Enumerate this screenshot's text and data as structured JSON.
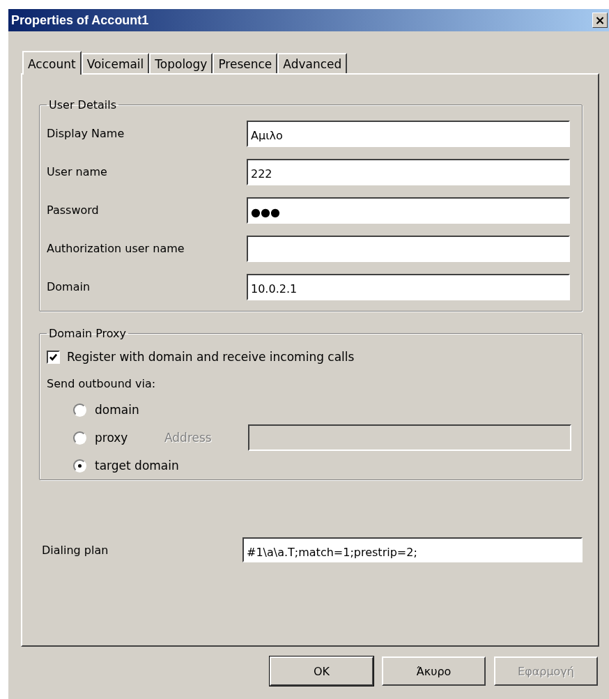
{
  "window": {
    "title": "Properties of Account1",
    "close": "×"
  },
  "tabs": [
    {
      "label": "Account",
      "selected": true
    },
    {
      "label": "Voicemail",
      "selected": false
    },
    {
      "label": "Topology",
      "selected": false
    },
    {
      "label": "Presence",
      "selected": false
    },
    {
      "label": "Advanced",
      "selected": false
    }
  ],
  "user_details": {
    "title": "User Details",
    "fields": [
      {
        "label": "Display Name",
        "value": "Αμιλο"
      },
      {
        "label": "User name",
        "value": "222"
      },
      {
        "label": "Password",
        "value": "●●●"
      },
      {
        "label": "Authorization user name"
      },
      {
        "label": "Domain",
        "value": "10.0.2.1"
      }
    ]
  },
  "domain_proxy": {
    "title": "Domain Proxy",
    "register": {
      "label": "Register with domain and receive incoming calls",
      "checked": true
    },
    "send_label": "Send outbound via:",
    "options": [
      {
        "label": "domain",
        "selected": false
      },
      {
        "label": "proxy",
        "selected": false,
        "address_label": "Address",
        "disabled": true
      },
      {
        "label": "target domain",
        "selected": true
      }
    ]
  },
  "dialing_plan": {
    "label": "Dialing plan",
    "value": "#1\\a\\a.T;match=1;prestrip=2;"
  },
  "buttons": [
    {
      "label": "OK",
      "disabled": false,
      "default": true
    },
    {
      "label": "Άκυρο",
      "disabled": false,
      "default": false
    },
    {
      "label": "Εφαρμογή",
      "disabled": true,
      "default": false
    }
  ]
}
